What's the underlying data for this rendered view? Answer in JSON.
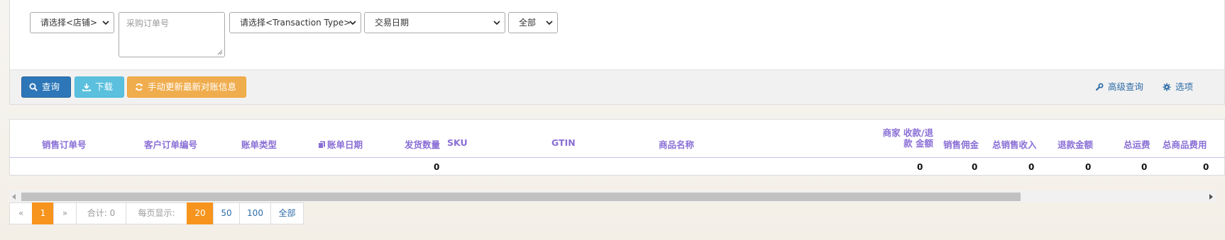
{
  "filters": {
    "shop_select": "请选择<店铺>",
    "po_placeholder": "采购订单号",
    "txn_type_select": "请选择<Transaction Type>",
    "date_select": "交易日期",
    "all_select": "全部"
  },
  "toolbar": {
    "query_label": "查询",
    "download_label": "下载",
    "refresh_label": "手动更新最新对账信息",
    "advanced_label": "高级查询",
    "options_label": "选项"
  },
  "table": {
    "columns": {
      "sales_order": "销售订单号",
      "customer_order": "客户订单编号",
      "bill_type": "账单类型",
      "bill_date": "账单日期",
      "ship_qty": "发货数量",
      "sku": "SKU",
      "gtin": "GTIN",
      "product_name": "商品名称",
      "merchant_amount_line1": "商家 收款/退",
      "merchant_amount_line2": "款 金额",
      "sales_commission": "销售佣金",
      "total_sales_income": "总销售收入",
      "refund_amount": "退款金额",
      "total_shipping": "总运费",
      "total_product_cost": "总商品费用"
    },
    "totals": {
      "ship_qty": "0",
      "merchant_amount": "0",
      "sales_commission": "0",
      "total_sales_income": "0",
      "refund_amount": "0",
      "total_shipping": "0",
      "total_product_cost": "0"
    }
  },
  "pagination": {
    "prev": "«",
    "current_page": "1",
    "next": "»",
    "total_label": "合计: 0",
    "per_page_label": "每页显示:",
    "sizes": [
      "20",
      "50",
      "100",
      "全部"
    ]
  },
  "colors": {
    "primary": "#2d77b9",
    "info": "#5bc0de",
    "warning": "#f0ad4e",
    "header_text": "#8a6fd6",
    "pager_active": "#f7941d"
  }
}
